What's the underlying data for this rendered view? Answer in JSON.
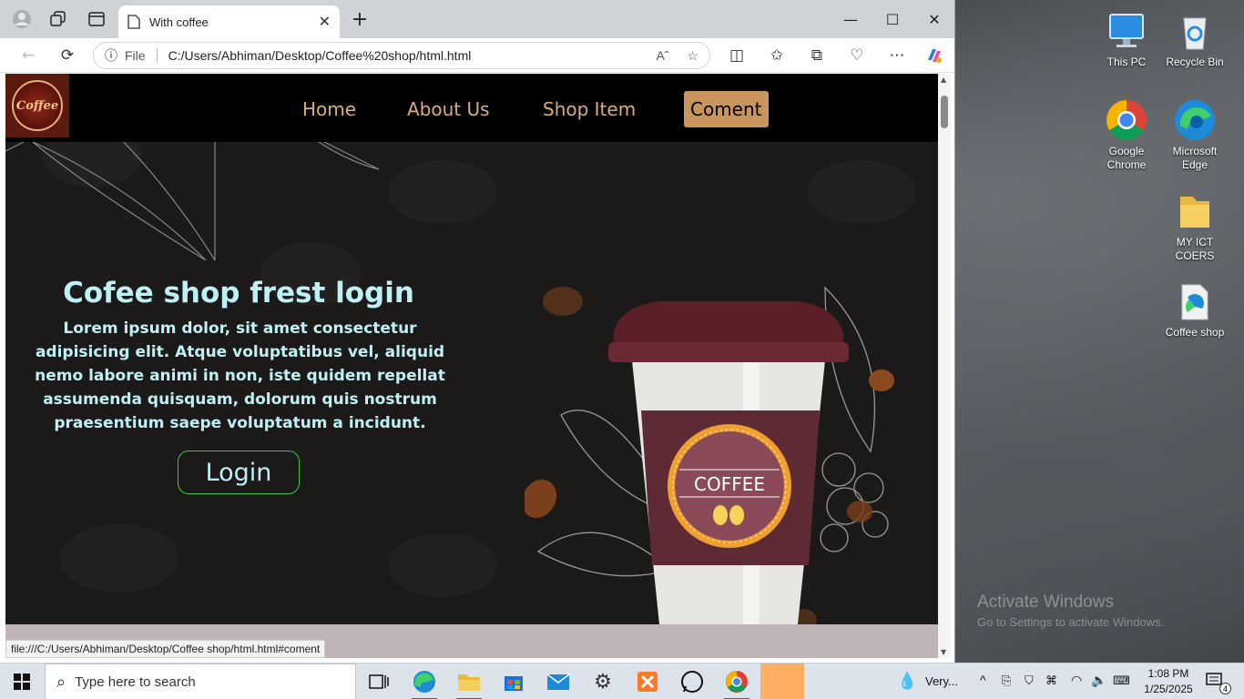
{
  "browser": {
    "tab_title": "With coffee",
    "url_prefix": "File",
    "url": "C:/Users/Abhiman/Desktop/Coffee%20shop/html.html",
    "status_url": "file:///C:/Users/Abhiman/Desktop/Coffee shop/html.html#coment"
  },
  "site": {
    "logo_text": "Coffee",
    "nav": [
      "Home",
      "About Us",
      "Shop Item",
      "Coment"
    ],
    "hero_title": "Cofee shop frest login",
    "hero_text": "Lorem ipsum dolor, sit amet consectetur adipisicing elit. Atque voluptatibus vel, aliquid nemo labore animi in non, iste quidem repellat assumenda quisquam, dolorum quis nostrum praesentium saepe voluptatum a incidunt.",
    "login_label": "Login",
    "cup_label": "COFFEE"
  },
  "desktop": {
    "icons": [
      "This PC",
      "Recycle Bin",
      "Google Chrome",
      "Microsoft Edge",
      "MY ICT COERS",
      "Coffee shop"
    ],
    "activate_title": "Activate Windows",
    "activate_sub": "Go to Settings to activate Windows."
  },
  "taskbar": {
    "search_placeholder": "Type here to search",
    "weather": "Very...",
    "time": "1:08 PM",
    "date": "1/25/2025",
    "notifications": "4"
  },
  "colors": {
    "nav_text": "#d9ad7c",
    "nav_active_bg": "#c8955f",
    "hero_text": "#bff0f5",
    "login_border": "#33cc44"
  }
}
